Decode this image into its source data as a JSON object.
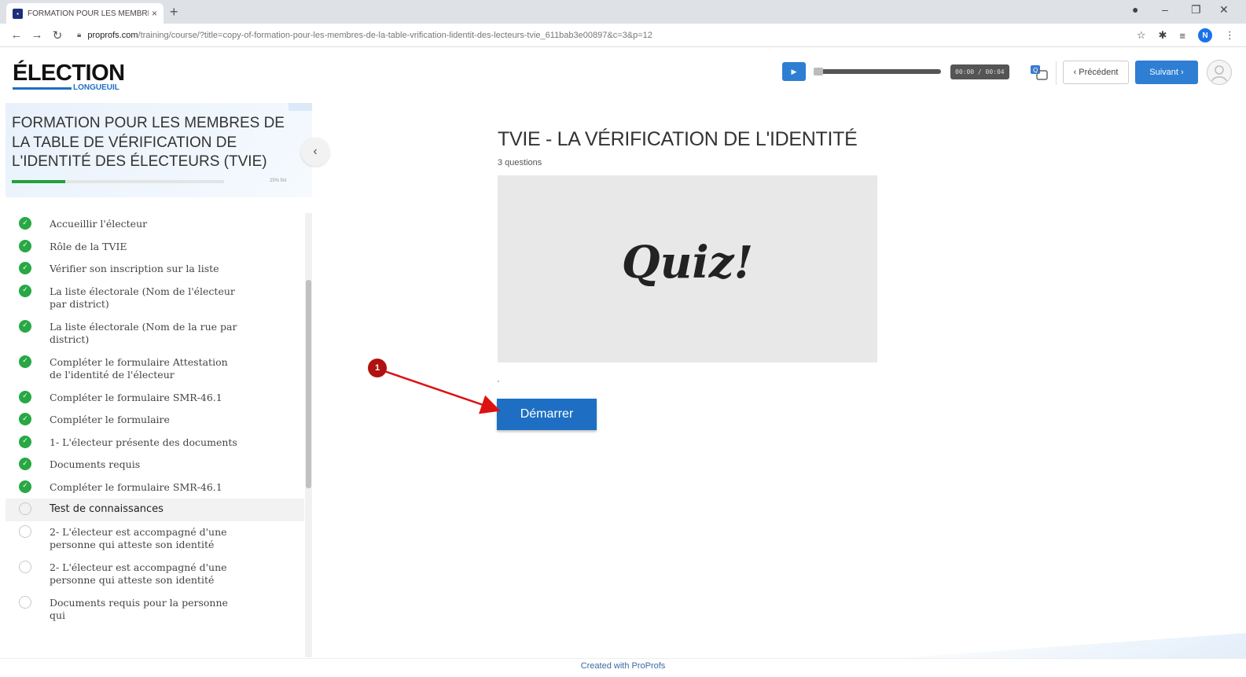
{
  "browser": {
    "tab_title": "FORMATION POUR LES MEMBRE",
    "tab_close": "×",
    "new_tab": "+",
    "url_host": "proprofs.com",
    "url_path": "/training/course/?title=copy-of-formation-pour-les-membres-de-la-table-vrification-lidentit-des-lecteurs-tvie_611bab3e00897&c=3&p=12",
    "profile_initial": "N"
  },
  "header": {
    "logo_main": "ÉLECTION",
    "logo_sub": "LONGUEUIL",
    "time": "00:00 / 00:04",
    "prev_label": "‹ Précédent",
    "next_label": "Suivant ›"
  },
  "sidebar": {
    "course_title": "FORMATION POUR LES MEMBRES DE LA TABLE DE VÉRIFICATION DE L'IDENTITÉ DES ÉLECTEURS (TVIE)",
    "progress_fraction": 0.25,
    "progress_label": "25% fini",
    "items": [
      {
        "label": "Accueillir l'électeur",
        "done": true
      },
      {
        "label": "Rôle de la TVIE",
        "done": true
      },
      {
        "label": "Vérifier son inscription sur la liste",
        "done": true
      },
      {
        "label": "La liste électorale (Nom de l'électeur par district)",
        "done": true
      },
      {
        "label": "La liste électorale (Nom de la rue par district)",
        "done": true
      },
      {
        "label": "Compléter le formulaire Attestation de l'identité de l'électeur",
        "done": true
      },
      {
        "label": "Compléter le formulaire SMR-46.1",
        "done": true
      },
      {
        "label": "Compléter le formulaire",
        "done": true
      },
      {
        "label": "1- L'électeur présente des documents",
        "done": true
      },
      {
        "label": "Documents requis",
        "done": true
      },
      {
        "label": "Compléter le formulaire SMR-46.1",
        "done": true
      },
      {
        "label": "Test de connaissances",
        "done": false
      },
      {
        "label": "2- L'électeur est accompagné d'une personne qui atteste son identité",
        "done": false
      },
      {
        "label": "2- L'électeur est accompagné d'une personne qui atteste son identité",
        "done": false
      },
      {
        "label": "Documents requis pour la personne qui",
        "done": false
      }
    ]
  },
  "main": {
    "title": "TVIE - LA VÉRIFICATION DE L'IDENTITÉ",
    "questions": "3 questions",
    "quiz_image_text": "Quiz!",
    "start_label": "Démarrer",
    "annotation_number": "1"
  },
  "footer": {
    "text": "Created with ProProfs"
  },
  "colors": {
    "primary": "#2e7fd3",
    "done_green": "#27a844",
    "annotation_red": "#b01111"
  }
}
